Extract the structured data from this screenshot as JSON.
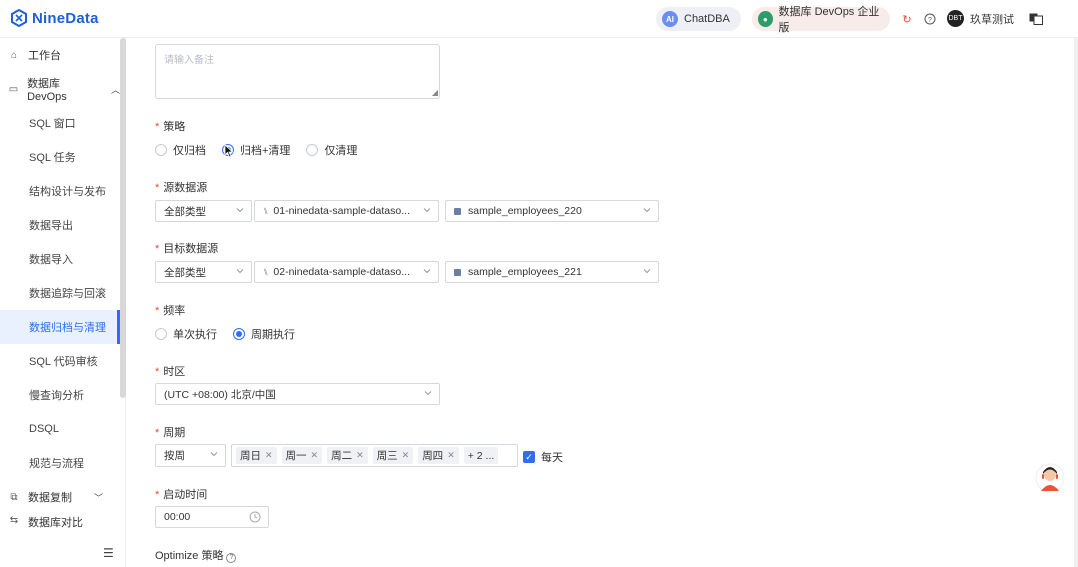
{
  "header": {
    "logo": "NineData",
    "chatdba": "ChatDBA",
    "edition": "数据库 DevOps 企业版",
    "user_avatar": "DBT",
    "username": "玖草测试"
  },
  "sidebar": {
    "workbench": "工作台",
    "devops": "数据库 DevOps",
    "items": [
      "SQL 窗口",
      "SQL 任务",
      "结构设计与发布",
      "数据导出",
      "数据导入",
      "数据追踪与回滚",
      "数据归档与清理",
      "SQL 代码审核",
      "慢查询分析",
      "DSQL",
      "规范与流程"
    ],
    "replication": "数据复制",
    "compare": "数据库对比"
  },
  "form": {
    "remark_placeholder": "请输入备注",
    "strategy_label": "策略",
    "strategy_options": [
      "仅归档",
      "归档+清理",
      "仅清理"
    ],
    "strategy_selected": "归档+清理",
    "source_label": "源数据源",
    "source_type": "全部类型",
    "source_ds": "01-ninedata-sample-dataso...",
    "source_db": "sample_employees_220",
    "target_label": "目标数据源",
    "target_type": "全部类型",
    "target_ds": "02-ninedata-sample-dataso...",
    "target_db": "sample_employees_221",
    "freq_label": "频率",
    "freq_options": [
      "单次执行",
      "周期执行"
    ],
    "freq_selected": "周期执行",
    "tz_label": "时区",
    "tz_value": "(UTC +08:00) 北京/中国",
    "period_label": "周期",
    "period_unit": "按周",
    "period_days": [
      "周日",
      "周一",
      "周二",
      "周三",
      "周四"
    ],
    "period_more": "+ 2 ...",
    "everyday": "每天",
    "start_label": "启动时间",
    "start_time": "00:00",
    "optimize_label": "Optimize 策略"
  },
  "colors": {
    "accent": "#2f6ef0",
    "required": "#e84a3c",
    "active_bg": "#eaf1fe"
  }
}
